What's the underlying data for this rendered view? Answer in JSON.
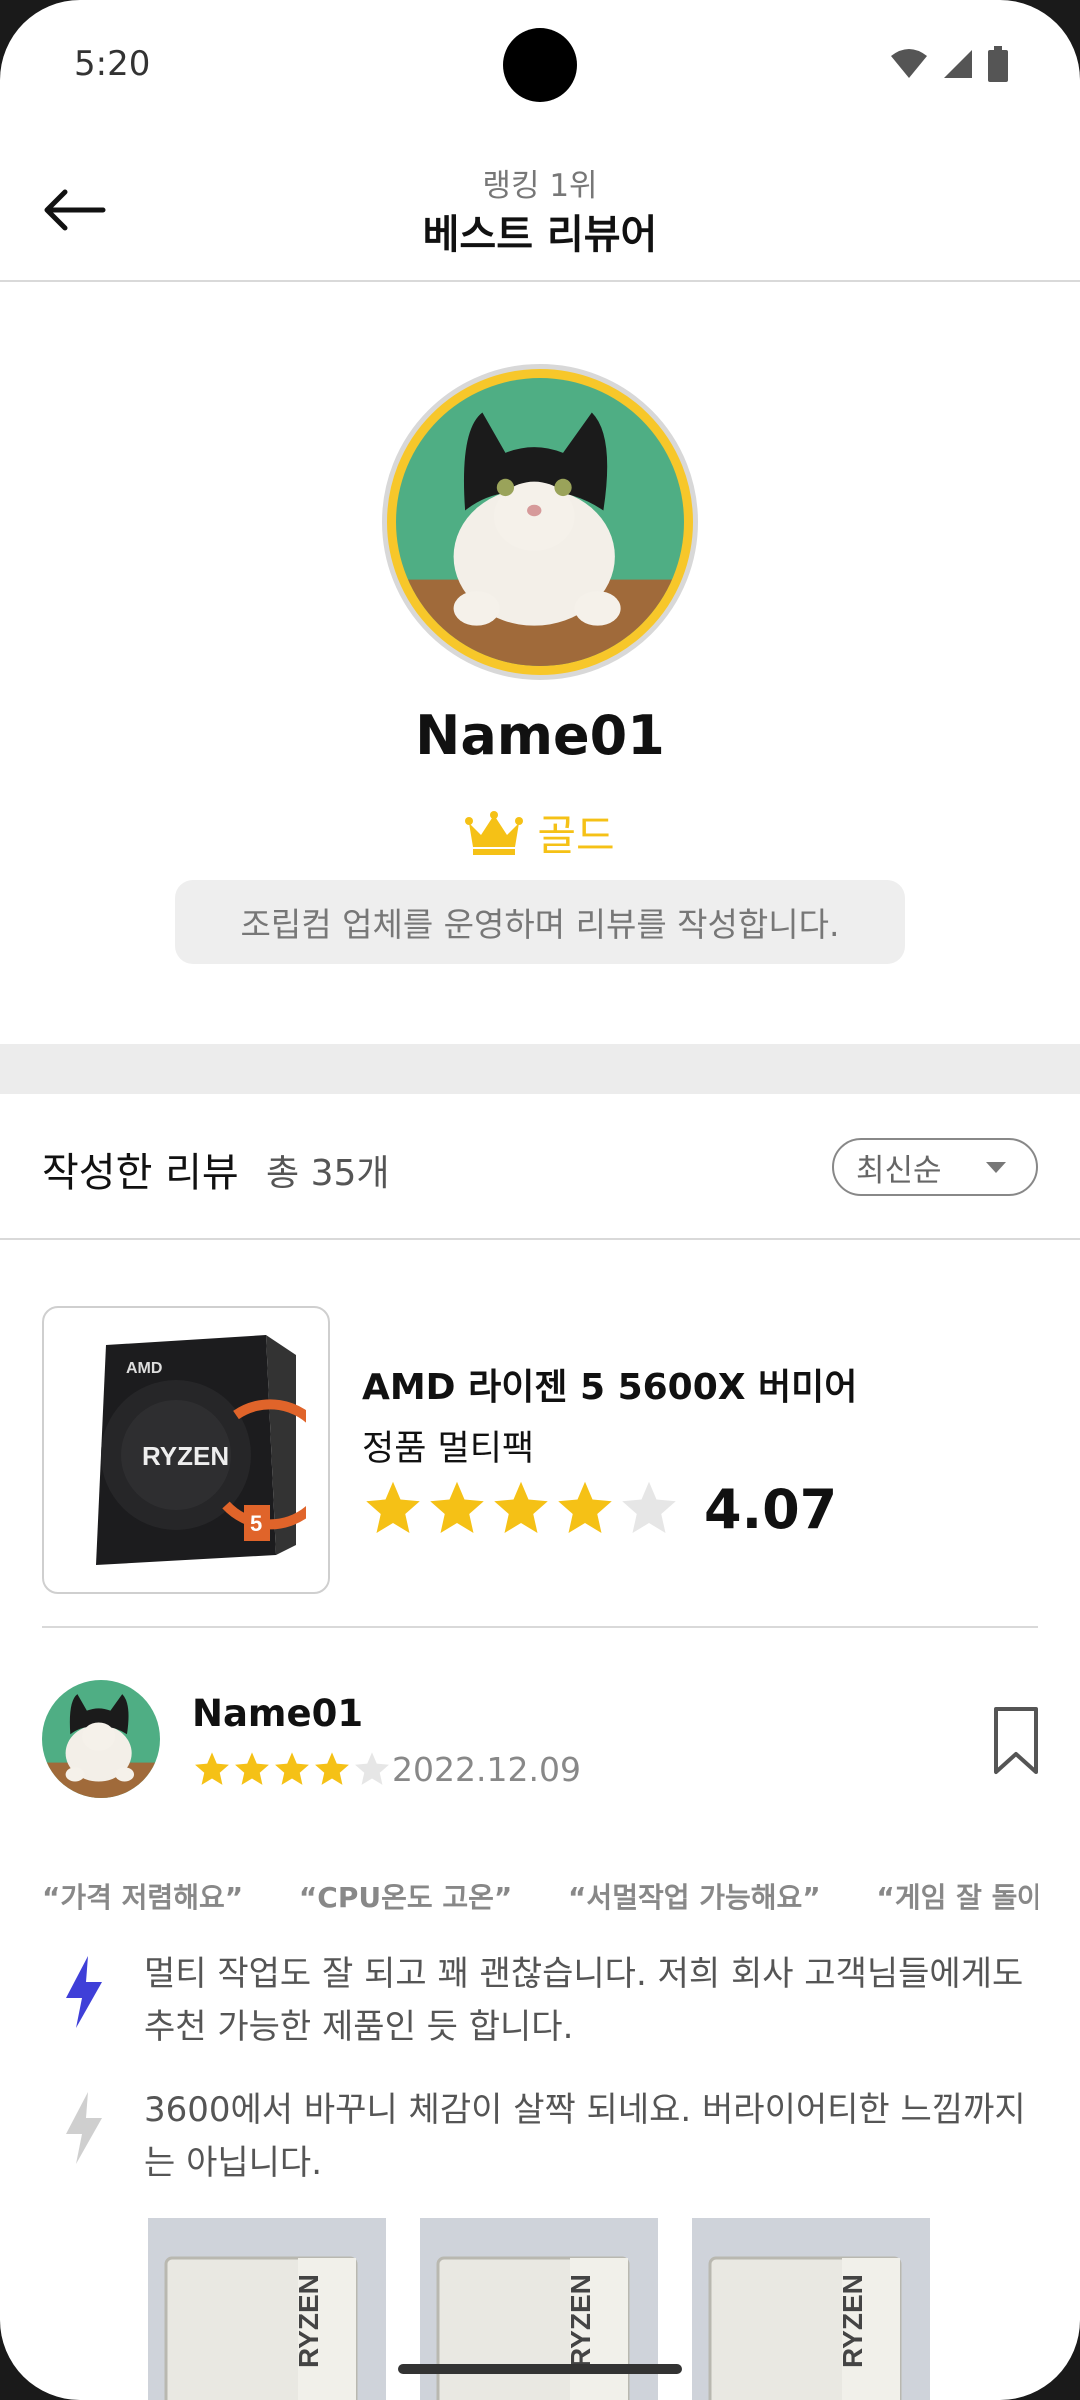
{
  "status_bar": {
    "time": "5:20"
  },
  "header": {
    "subtitle": "랭킹 1위",
    "title": "베스트 리뷰어"
  },
  "profile": {
    "name": "Name01",
    "grade": "골드",
    "bio": "조립컴 업체를 운영하며 리뷰를 작성합니다.",
    "accent_color": "#f5c116"
  },
  "reviews_section": {
    "title": "작성한 리뷰",
    "count": "총 35개",
    "sort": {
      "selected": "최신순"
    }
  },
  "product": {
    "name_line1": "AMD 라이젠 5 5600X 버미어",
    "name_line2": "정품 멀티팩",
    "rating": 4.07,
    "rating_label": "4.07",
    "box_brand": "AMD",
    "box_label": "RYZEN",
    "box_number": "5"
  },
  "review": {
    "author": "Name01",
    "rating": 4,
    "date": "2022.12.09",
    "tags": [
      "“가격 저렴해요”",
      "“CPU온도 고온”",
      "“서멀작업 가능해요”",
      "“게임 잘 돌아가요”"
    ],
    "pros": "멀티 작업도 잘 되고 꽤 괜찮습니다. 저희 회사 고객님들에게도 추천 가능한 제품인 듯 합니다.",
    "cons": "3600에서 바꾸니 체감이 살짝 되네요. 버라이어티한 느낌까지는 아닙니다.",
    "photo_label": "RYZEN"
  },
  "colors": {
    "star": "#f5c116",
    "star_empty": "#e6e6e6",
    "pros_icon": "#3f3fd8",
    "cons_icon": "#cfcfcf"
  }
}
